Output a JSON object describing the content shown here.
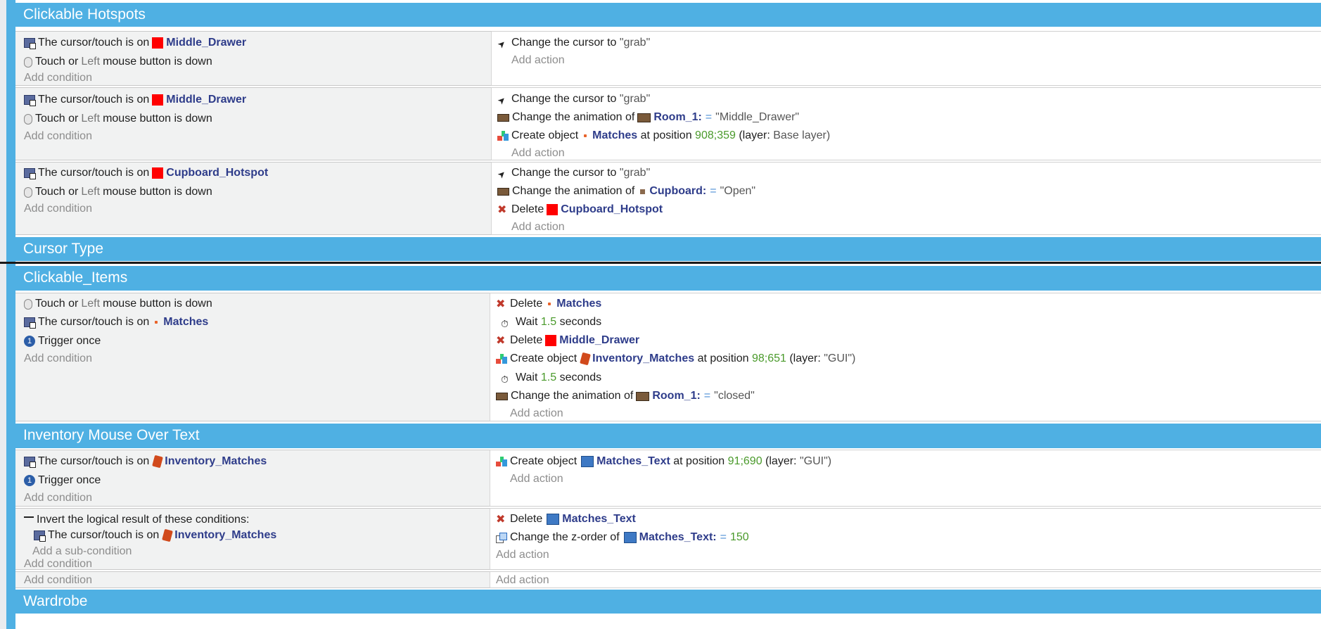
{
  "common": {
    "add_condition": "Add condition",
    "add_action": "Add action",
    "add_sub_condition": "Add a sub-condition",
    "cursor_on": "The cursor/touch is on",
    "touch_or": "Touch or",
    "left": "Left",
    "mouse_down": "mouse button is down",
    "trigger_once": "Trigger once",
    "invert": "Invert the logical result of these conditions:",
    "change_cursor": "Change the cursor to",
    "grab": "\"grab\"",
    "change_anim": "Change the animation of",
    "create_object": "Create object",
    "at_position": "at position",
    "layer_label": "(layer:",
    "delete": "Delete",
    "wait": "Wait",
    "seconds": "seconds",
    "change_z": "Change the z-order of",
    "equals": "=",
    "colon": ":",
    "once_glyph": "1"
  },
  "groups": {
    "clickable_hotspots": "Clickable Hotspots",
    "cursor_type": "Cursor Type",
    "clickable_items": "Clickable_Items",
    "inventory_mouse_over": "Inventory Mouse Over Text",
    "wardrobe": "Wardrobe"
  },
  "objects": {
    "middle_drawer": "Middle_Drawer",
    "cupboard_hotspot": "Cupboard_Hotspot",
    "room1": "Room_1",
    "matches": "Matches",
    "cupboard": "Cupboard",
    "inventory_matches": "Inventory_Matches",
    "matches_text": "Matches_Text"
  },
  "values": {
    "anim_middle_drawer": "\"Middle_Drawer\"",
    "anim_open": "\"Open\"",
    "anim_closed": "\"closed\"",
    "pos1": "908;359",
    "layer1": "Base layer)",
    "wait1": "1.5",
    "pos2": "98;651",
    "layer_gui": "\"GUI\")",
    "pos3": "91;690",
    "z_value": "150"
  },
  "colors": {
    "group_bar": "#4fb0e3",
    "object_name": "#2e3c8a",
    "number": "#4a9a2b",
    "operator": "#4d8fd6"
  }
}
